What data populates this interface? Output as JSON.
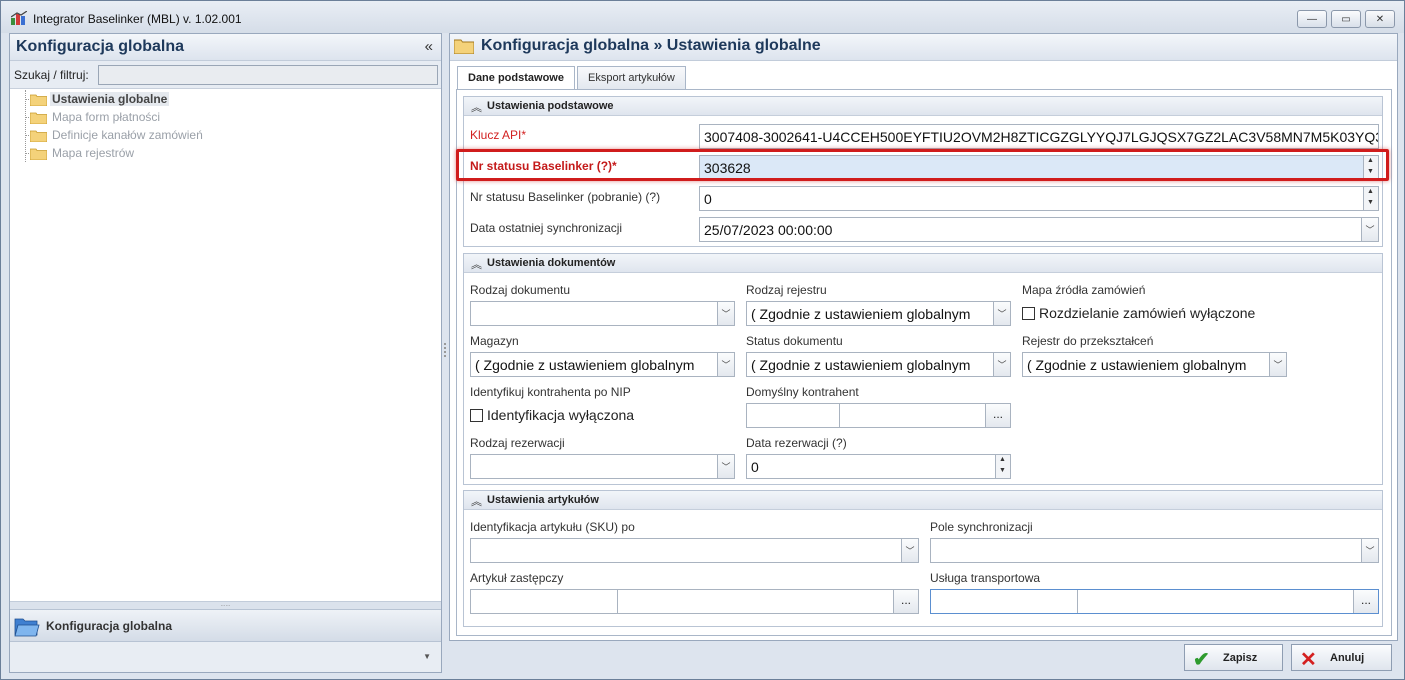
{
  "window": {
    "title": "Integrator Baselinker (MBL) v. 1.02.001",
    "controls": {
      "minimize": "—",
      "maximize": "▭",
      "close": "✕"
    }
  },
  "left_panel": {
    "title": "Konfiguracja globalna",
    "collapse_icon": "«",
    "filter_label": "Szukaj / filtruj:",
    "filter_value": "",
    "tree": [
      {
        "label": "Ustawienia globalne",
        "selected": true
      },
      {
        "label": "Mapa form płatności",
        "selected": false
      },
      {
        "label": "Definicje kanałów zamówień",
        "selected": false
      },
      {
        "label": "Mapa rejestrów",
        "selected": false
      }
    ],
    "nav_item": "Konfiguracja globalna"
  },
  "right_panel": {
    "title": "Konfiguracja globalna » Ustawienia globalne",
    "tabs": [
      {
        "label": "Dane podstawowe",
        "active": true
      },
      {
        "label": "Eksport artykułów",
        "active": false
      }
    ],
    "basic": {
      "title": "Ustawienia podstawowe",
      "api_key_label": "Klucz API*",
      "api_key_value": "3007408-3002641-U4CCEH500EYFTIU2OVM2H8ZTICGZGLYYQJ7LGJQSX7GZ2LAC3V58MN7M5K03YQ3",
      "status_label": "Nr statusu Baselinker (?)*",
      "status_value": "303628",
      "status_fetch_label": "Nr statusu Baselinker (pobranie) (?)",
      "status_fetch_value": "0",
      "last_sync_label": "Data ostatniej synchronizacji",
      "last_sync_value": "25/07/2023 00:00:00"
    },
    "documents": {
      "title": "Ustawienia dokumentów",
      "doc_type_label": "Rodzaj dokumentu",
      "doc_type_value": "",
      "register_type_label": "Rodzaj rejestru",
      "register_type_value": "( Zgodnie z ustawieniem globalnym",
      "order_source_label": "Mapa źródła zamówień",
      "order_split_label": "Rozdzielanie zamówień wyłączone",
      "warehouse_label": "Magazyn",
      "warehouse_value": "( Zgodnie z ustawieniem globalnym",
      "doc_status_label": "Status dokumentu",
      "doc_status_value": "( Zgodnie z ustawieniem globalnym",
      "transform_register_label": "Rejestr do przekształceń",
      "transform_register_value": "( Zgodnie z ustawieniem globalnym",
      "nip_label": "Identyfikuj kontrahenta po NIP",
      "nip_check_label": "Identyfikacja wyłączona",
      "default_contractor_label": "Domyślny kontrahent",
      "reservation_type_label": "Rodzaj rezerwacji",
      "reservation_type_value": "",
      "reservation_date_label": "Data rezerwacji (?)",
      "reservation_date_value": "0"
    },
    "articles": {
      "title": "Ustawienia artykułów",
      "sku_label": "Identyfikacja artykułu (SKU) po",
      "sku_value": "",
      "sync_field_label": "Pole synchronizacji",
      "sync_field_value": "",
      "substitute_label": "Artykuł zastępczy",
      "transport_label": "Usługa transportowa"
    }
  },
  "buttons": {
    "save": "Zapisz",
    "cancel": "Anuluj",
    "ellipsis": "...",
    "dropdown_arrow": "﹀"
  },
  "icons": {
    "app": "app-logo-icon",
    "folder": "folder-icon",
    "open_folder": "open-folder-icon",
    "save": "checkmark-icon",
    "cancel": "x-icon"
  },
  "colors": {
    "required_label": "#d21f1f",
    "highlight_border": "#d01c1c",
    "title_text": "#1e395b",
    "save_green": "#2e9b2e",
    "cancel_red": "#d42020"
  }
}
